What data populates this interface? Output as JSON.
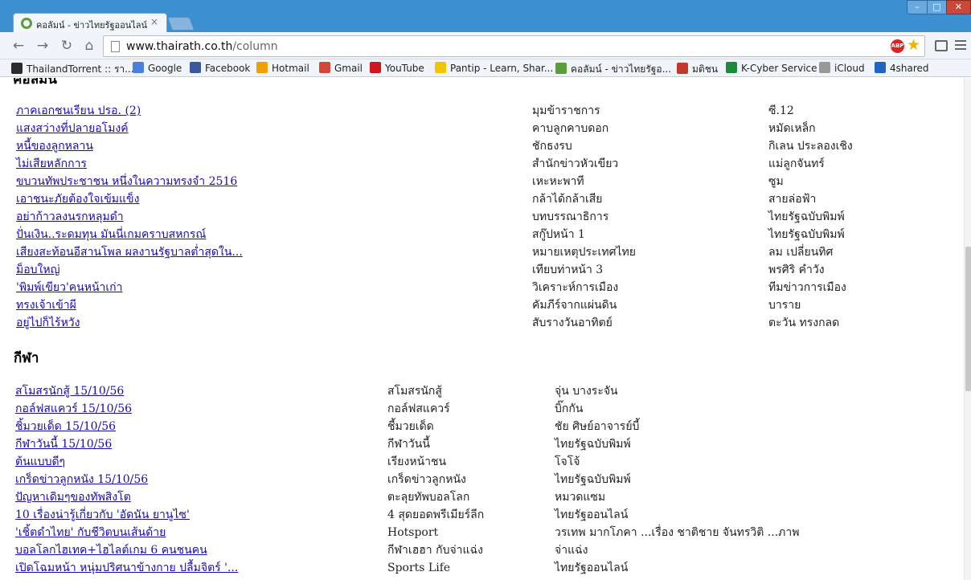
{
  "browser": {
    "tab_title": "คอลัมน์ - ข่าวไทยรัฐออนไลน์",
    "tab_close": "×",
    "url_host": "www.thairath.co.th",
    "url_path": "/column",
    "abp_label": "ABP"
  },
  "bookmarks": [
    {
      "label": "ThailandTorrent :: รา...",
      "icon_color": "#2b2b2b"
    },
    {
      "label": "Google",
      "icon_color": "#4a7fdc"
    },
    {
      "label": "Facebook",
      "icon_color": "#3b5998"
    },
    {
      "label": "Hotmail",
      "icon_color": "#f0a000"
    },
    {
      "label": "Gmail",
      "icon_color": "#d44638"
    },
    {
      "label": "YouTube",
      "icon_color": "#cc181e"
    },
    {
      "label": "Pantip - Learn, Shar...",
      "icon_color": "#f5c400"
    },
    {
      "label": "คอลัมน์ - ข่าวไทยรัฐอ...",
      "icon_color": "#5a9e3a"
    },
    {
      "label": "มติชน",
      "icon_color": "#c0392b"
    },
    {
      "label": "K-Cyber Service",
      "icon_color": "#1f8a3b"
    },
    {
      "label": "iCloud",
      "icon_color": "#999999"
    },
    {
      "label": "4shared",
      "icon_color": "#1f66c2"
    }
  ],
  "columns": {
    "cut_heading": "คอลัมน์",
    "rows": [
      {
        "title": "ภาคเอกชนเรียน ปรอ. (2)",
        "column": "มุมข้าราชการ",
        "author": "ซี.12"
      },
      {
        "title": "แสงสว่างที่ปลายอโมงค์",
        "column": "คาบลูกคาบดอก",
        "author": "หมัดเหล็ก"
      },
      {
        "title": "หนี้ของลูกหลาน",
        "column": "ชักธงรบ",
        "author": "กิเลน ประลองเชิง"
      },
      {
        "title": "ไม่เสียหลักการ",
        "column": "สำนักข่าวหัวเขียว",
        "author": "แม่ลูกจันทร์"
      },
      {
        "title": "ขบวนทัพประชาชน หนึ่งในความทรงจำ 2516",
        "column": "เหะหะพาที",
        "author": "ซูม"
      },
      {
        "title": "เอาชนะภัยต้องใจเข้มแข็ง",
        "column": "กล้าได้กล้าเสีย",
        "author": "สายล่อฟ้า"
      },
      {
        "title": "อย่าก้าวลงนรกหลุมดำ",
        "column": "บทบรรณาธิการ",
        "author": "ไทยรัฐฉบับพิมพ์"
      },
      {
        "title": "ปั่นเงิน..ระดมทุน มันนี่เกมคราบสหกรณ์",
        "column": "สกู๊ปหน้า 1",
        "author": "ไทยรัฐฉบับพิมพ์"
      },
      {
        "title": "เสียงสะท้อนอีสานโพล ผลงานรัฐบาลต่ำสุดใน...",
        "column": "หมายเหตุประเทศไทย",
        "author": "ลม เปลี่ยนทิศ"
      },
      {
        "title": "ม็อบใหญ่",
        "column": "เทียบท่าหน้า 3",
        "author": "พรศิริ คำวัง"
      },
      {
        "title": "'พิมพ์เขียว'คนหน้าเก่า",
        "column": "วิเคราะห์การเมือง",
        "author": "ทีมข่าวการเมือง"
      },
      {
        "title": "ทรงเจ้าเข้าผี",
        "column": "คัมภีร์จากแผ่นดิน",
        "author": "บาราย"
      },
      {
        "title": "อยู่ไปก็ไร้หวัง",
        "column": "สับรางวันอาทิตย์",
        "author": "ตะวัน ทรงกลด"
      }
    ]
  },
  "sports": {
    "heading": "กีฬา",
    "rows": [
      {
        "title": "สโมสรนักสู้ 15/10/56",
        "column": "สโมสรนักสู้",
        "author": "จุ่น บางระจัน"
      },
      {
        "title": "กอล์ฟสแควร์ 15/10/56",
        "column": "กอล์ฟสแควร์",
        "author": "บิ๊กกัน"
      },
      {
        "title": "ชิ้มวยเด็ด 15/10/56",
        "column": "ชี้มวยเด็ด",
        "author": "ชัย ศิษย์อาจารย์บี้"
      },
      {
        "title": "กีฬาวันนี้ 15/10/56",
        "column": "กีฬาวันนี้",
        "author": "ไทยรัฐฉบับพิมพ์"
      },
      {
        "title": "ต้นแบบดีๆ",
        "column": "เรียงหน้าชน",
        "author": "โจโจ้"
      },
      {
        "title": "เกร็ดข่าวลูกหนัง 15/10/56",
        "column": "เกร็ดข่าวลูกหนัง",
        "author": "ไทยรัฐฉบับพิมพ์"
      },
      {
        "title": "ปัญหาเดิมๆของทัพสิงโต",
        "column": "ตะลุยทัพบอลโลก",
        "author": "หมวดแซม"
      },
      {
        "title": "10 เรื่องน่ารู้เกี่ยวกับ 'อัดนัน ยานูไซ'",
        "column": "4 สุดยอดพรีเมียร์ลีก",
        "author": "ไทยรัฐออนไลน์"
      },
      {
        "title": "'เชิ้ตดำไทย' กับชีวิตบนเส้นด้าย",
        "column": "Hotsport",
        "author": "วรเทพ มากโภคา ...เรื่อง ชาติชาย จันทรวิติ ...ภาพ"
      },
      {
        "title": "บอลโลกไฮเทค+ไฮไลต์เกม 6 คนชนคน",
        "column": "กีฬาเฮฮา กับจ่าแฉ่ง",
        "author": "จ่าแฉ่ง"
      },
      {
        "title": "เปิดโฉมหน้า หนุ่มปริศนาข้างกาย ปลื้มจิตร์ '...",
        "column": "Sports Life",
        "author": "ไทยรัฐออนไลน์"
      }
    ]
  }
}
